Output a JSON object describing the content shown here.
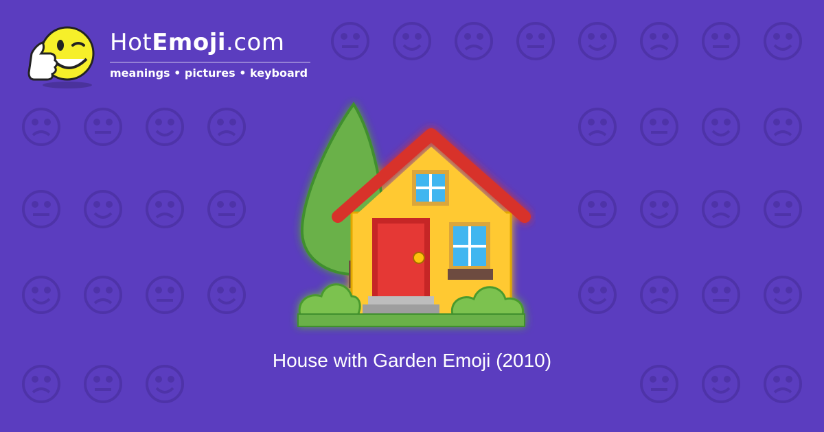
{
  "logo": {
    "name_regular": "Hot",
    "name_bold": "Emoji",
    "name_suffix": ".com",
    "tagline": "meanings • pictures • keyboard"
  },
  "hero": {
    "icon": "house-with-garden-icon",
    "caption": "House with Garden Emoji (2010)"
  },
  "background": {
    "color": "#5b3dbf",
    "pattern_color": "#4e33a8"
  }
}
